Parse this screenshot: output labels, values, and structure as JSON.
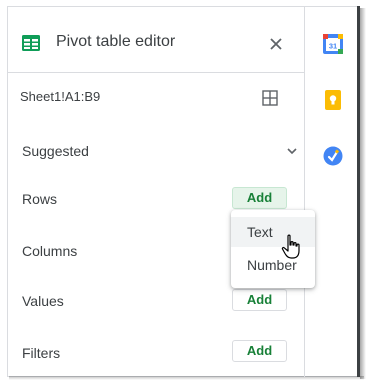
{
  "panel": {
    "title": "Pivot table editor",
    "range": "Sheet1!A1:B9",
    "sections": {
      "suggested": "Suggested",
      "rows": "Rows",
      "columns": "Columns",
      "values": "Values",
      "filters": "Filters"
    },
    "add_label": "Add"
  },
  "menu": {
    "items": [
      "Text",
      "Number"
    ]
  },
  "side_icons": [
    "calendar-icon",
    "keep-icon",
    "tasks-icon"
  ],
  "colors": {
    "accent_green": "#188038",
    "sheets_green": "#0f9d58",
    "calendar_blue": "#4285f4",
    "keep_yellow": "#fbbc04",
    "tasks_blue": "#4285f4"
  }
}
